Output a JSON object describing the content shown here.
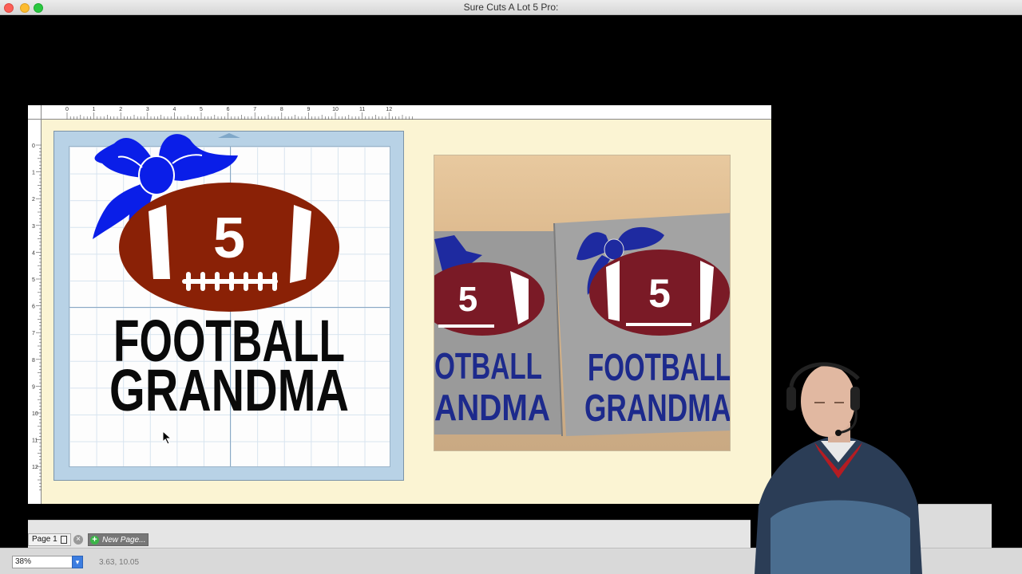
{
  "window": {
    "title": "Sure Cuts A Lot 5 Pro:"
  },
  "rulers": {
    "top_labels": [
      "0",
      "1",
      "2",
      "3",
      "4",
      "5",
      "6",
      "7",
      "8",
      "9",
      "10",
      "11",
      "12"
    ],
    "left_labels": [
      "0",
      "1",
      "2",
      "3",
      "4",
      "5",
      "6",
      "7",
      "8",
      "9",
      "10",
      "11",
      "12"
    ]
  },
  "design": {
    "number": "5",
    "line1": "FOOTBALL",
    "line2": "GRANDMA",
    "colors": {
      "bow": "#0a1ee8",
      "football": "#8a2106",
      "text": "#0a0a0a",
      "laces": "#ffffff"
    }
  },
  "photo": {
    "left_shirt": {
      "number": "5",
      "line1": "OTBALL",
      "line2": "ANDMA"
    },
    "right_shirt": {
      "number": "5",
      "line1": "FOOTBALL",
      "line2": "GRANDMA"
    },
    "colors": {
      "shirt": "#9a9a9a",
      "bow": "#1e2aa0",
      "football": "#7a1a26",
      "text": "#1d2a8c"
    }
  },
  "page_bar": {
    "page_tab": "Page 1",
    "new_page": "New Page..."
  },
  "status": {
    "zoom": "38%",
    "coords": "3.63, 10.05"
  }
}
